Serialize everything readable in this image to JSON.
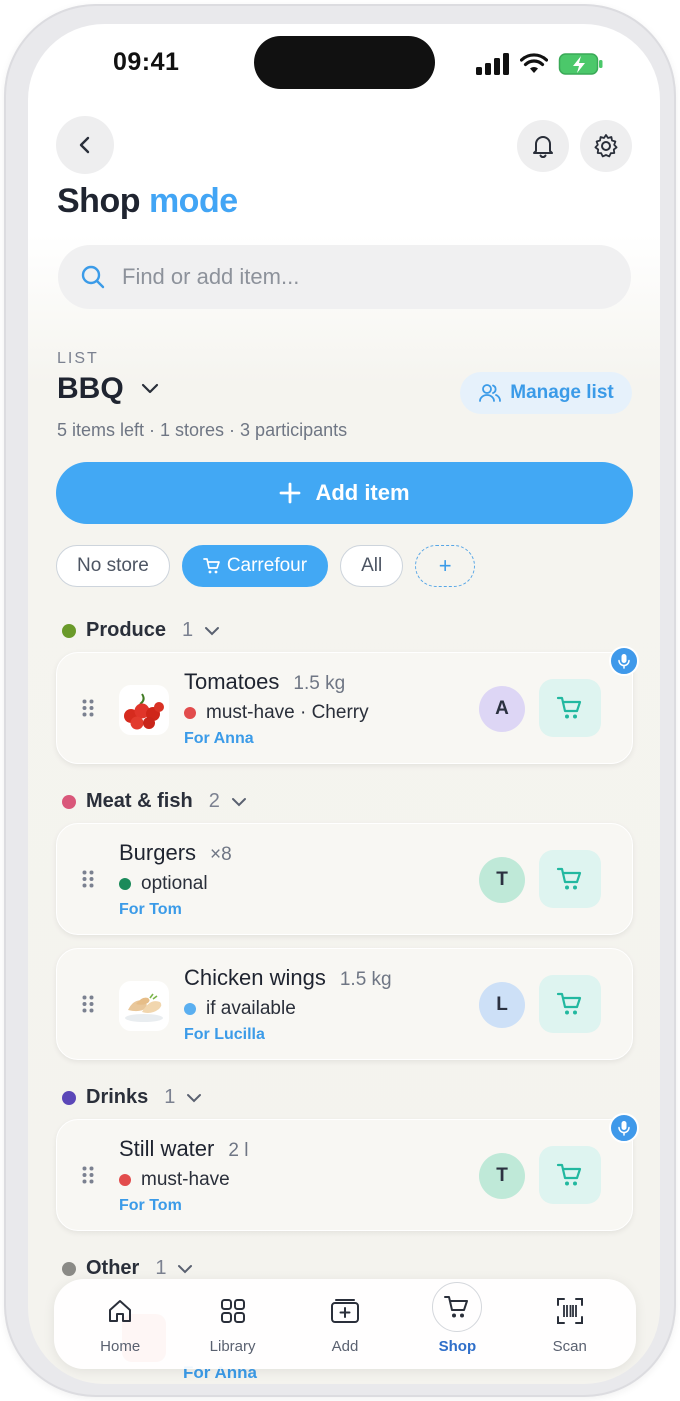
{
  "status_bar": {
    "time": "09:41"
  },
  "header": {
    "title_main": "Shop",
    "title_accent": "mode"
  },
  "search": {
    "placeholder": "Find or add item..."
  },
  "list": {
    "label": "LIST",
    "name": "BBQ",
    "manage_label": "Manage list",
    "meta": "5 items left · 1 stores · 3 participants"
  },
  "add_item": {
    "label": "Add item"
  },
  "store_filters": [
    {
      "label": "No store"
    },
    {
      "label": "Carrefour"
    },
    {
      "label": "All"
    },
    {
      "label": "+"
    }
  ],
  "categories": [
    {
      "name": "Produce",
      "count": "1",
      "color": "#6a9a2a"
    },
    {
      "name": "Meat & fish",
      "count": "2",
      "color": "#d9577a"
    },
    {
      "name": "Drinks",
      "count": "1",
      "color": "#5b47b8"
    },
    {
      "name": "Other",
      "count": "1",
      "color": "#8a8a86"
    }
  ],
  "items": [
    {
      "name": "Tomatoes",
      "qty": "1.5 kg",
      "tag": "must-have · Cherry",
      "tag_color": "#e24c4c",
      "for": "For Anna",
      "avatar": "A",
      "avatar_color": "#ddd6f5",
      "icon": "tomatoes-icon"
    },
    {
      "name": "Burgers",
      "qty": "×8",
      "tag": "optional",
      "tag_color": "#1b8a5a",
      "for": "For Tom",
      "avatar": "T",
      "avatar_color": "#bfe9d8"
    },
    {
      "name": "Chicken wings",
      "qty": "1.5 kg",
      "tag": "if available",
      "tag_color": "#5aaff0",
      "for": "For Lucilla",
      "avatar": "L",
      "avatar_color": "#cde0f7",
      "icon": "chicken-wings-icon"
    },
    {
      "name": "Still water",
      "qty": "2 l",
      "tag": "must-have",
      "tag_color": "#e24c4c",
      "for": "For Tom",
      "avatar": "T",
      "avatar_color": "#bfe9d8"
    }
  ],
  "hidden_item": {
    "for": "For Anna"
  },
  "bottom_nav": [
    {
      "label": "Home",
      "icon": "home-icon"
    },
    {
      "label": "Library",
      "icon": "grid-icon"
    },
    {
      "label": "Add",
      "icon": "add-box-icon"
    },
    {
      "label": "Shop",
      "icon": "cart-icon",
      "active": true
    },
    {
      "label": "Scan",
      "icon": "barcode-scan-icon"
    }
  ]
}
